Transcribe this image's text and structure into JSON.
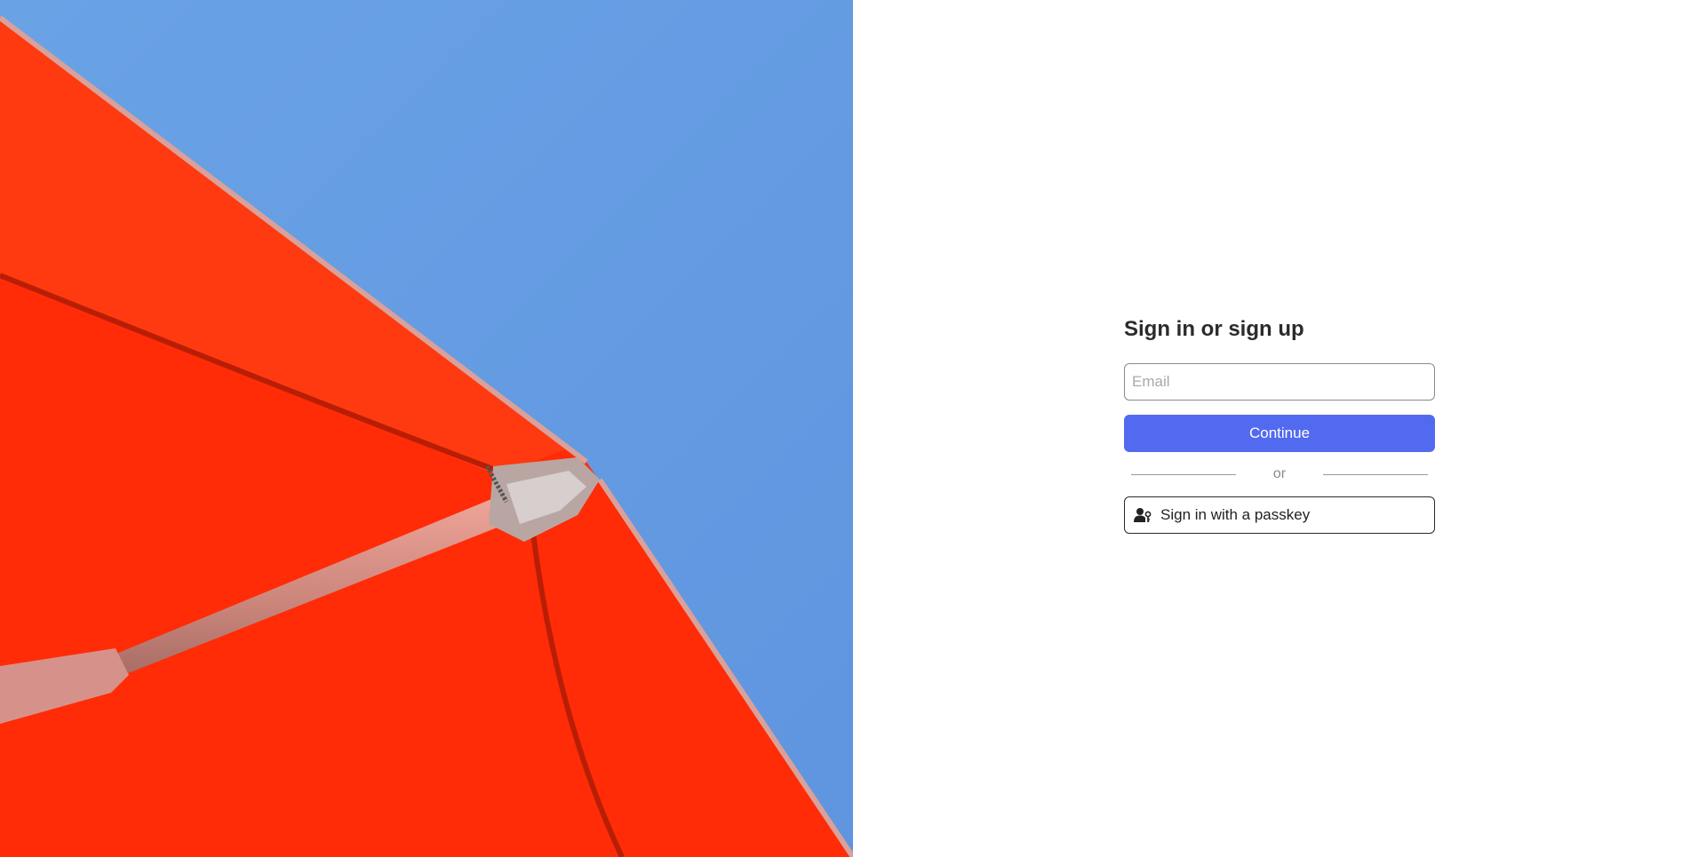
{
  "hero": {
    "image": "red-umbrella-against-blue-sky",
    "sky_color": "#649be2",
    "canopy_color": "#ff2a06"
  },
  "auth": {
    "title": "Sign in or sign up",
    "email_placeholder": "Email",
    "email_value": "",
    "continue_label": "Continue",
    "divider_text": "or",
    "passkey_label": "Sign in with a passkey",
    "passkey_icon": "user-key-icon"
  },
  "colors": {
    "primary": "#526aef",
    "text": "#2b2b2b"
  }
}
